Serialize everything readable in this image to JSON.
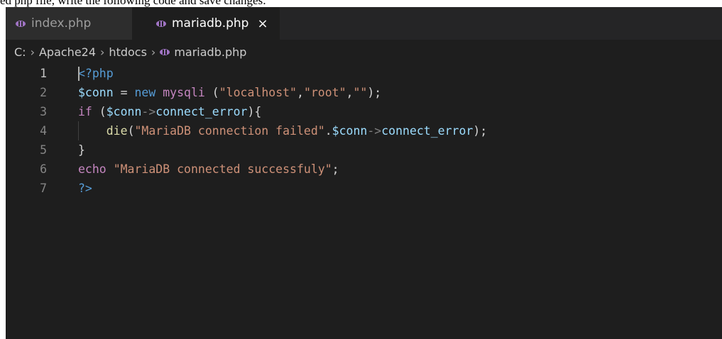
{
  "top_clip": {
    "text": "ed php file, write the following code and save changes:"
  },
  "tabs": [
    {
      "label": "index.php",
      "icon": "php-elephant-icon",
      "active": false
    },
    {
      "label": "mariadb.php",
      "icon": "php-elephant-icon",
      "active": true,
      "close": "×"
    }
  ],
  "breadcrumb": {
    "items": [
      "C:",
      "Apache24",
      "htdocs",
      "mariadb.php"
    ],
    "separator": "›"
  },
  "editor": {
    "line_numbers": [
      "1",
      "2",
      "3",
      "4",
      "5",
      "6",
      "7"
    ],
    "current_line": 1,
    "lines": {
      "l1": {
        "open_tag": "<?php"
      },
      "l2": {
        "var": "$conn",
        "eq": " = ",
        "new": "new ",
        "cls": "mysqli",
        "p1": " (",
        "s1": "\"localhost\"",
        "c1": ",",
        "s2": "\"root\"",
        "c2": ",",
        "s3": "\"\"",
        "end": ");"
      },
      "l3": {
        "kw": "if",
        "p1": " (",
        "var": "$conn",
        "arrow": "->",
        "prop": "connect_error",
        "end": "){"
      },
      "l4": {
        "fn": "die",
        "p1": "(",
        "s1": "\"MariaDB connection failed\"",
        "dot": ".",
        "var": "$conn",
        "arrow": "->",
        "prop": "connect_error",
        "end": ");"
      },
      "l5": {
        "brace": "}"
      },
      "l6": {
        "kw": "echo",
        "sp": " ",
        "s1": "\"MariaDB connected successfuly\"",
        "end": ";"
      },
      "l7": {
        "close_tag": "?>"
      }
    }
  },
  "colors": {
    "background": "#1e1e1e",
    "tabbar": "#252526",
    "php_icon": "#a074c4",
    "string": "#ce9178",
    "keyword": "#c586c0",
    "variable": "#9cdcfe"
  }
}
